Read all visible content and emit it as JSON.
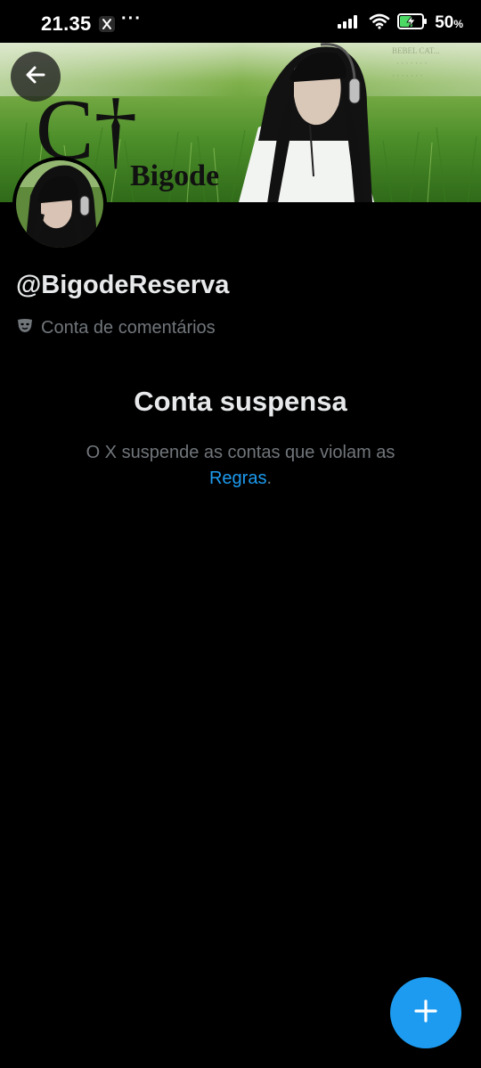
{
  "status_bar": {
    "time": "21.35",
    "more": "···",
    "battery_percent": "50",
    "battery_sign": "%"
  },
  "banner": {
    "logo_letters": "C†",
    "logo_word": "Bigode"
  },
  "profile": {
    "handle": "@BigodeReserva",
    "label": "Conta de comentários"
  },
  "notice": {
    "title": "Conta suspensa",
    "body_text": "O X suspende as contas que violam as",
    "link_text": "Regras",
    "period": "."
  },
  "colors": {
    "background": "#000000",
    "accent": "#1d9bf0",
    "text_primary": "#e7e9ea",
    "text_secondary": "#71767b"
  },
  "icons": {
    "back": "arrow-left-icon",
    "compose": "plus-icon",
    "label": "theater-masks-icon"
  }
}
